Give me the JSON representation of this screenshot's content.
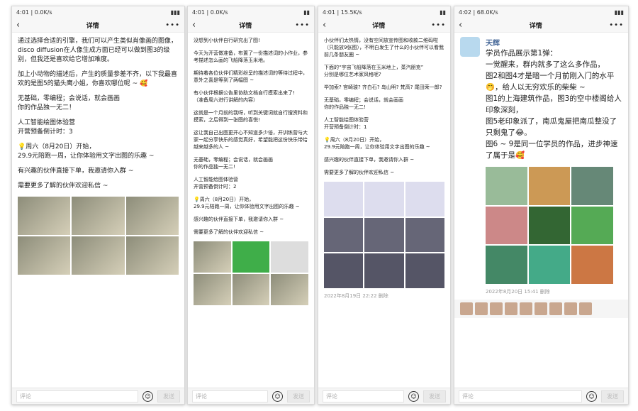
{
  "common": {
    "title": "详情",
    "comment_placeholder": "评论",
    "send": "发送",
    "more": "•••"
  },
  "phones": [
    {
      "time": "4:01 | 0.0K/s",
      "paras": [
        "通过选择合适的引擎，我们可以产生类似肖像画的图像，disco diffusion在人像生成方面已经可以做到图3的级别，但我还是喜欢给它增加难度。",
        "加上小动物的描述后，产生的质量参差不齐，以下我最喜欢的是图5的猫头鹰小姐，你喜欢哪位呢 ~ 🥰",
        "无基础，零编程；会说话，就会画画\n你的作品独一无二！",
        "人工智能绘图体验营\n开营预备倒计时：3",
        "💡周六（8月20日）开始，\n29.9元陪跑一周，让你体验用文字出图的乐趣 ~",
        "有兴趣的伙伴直接下单，我邀请你入群 ~",
        "需要更多了解的伙伴欢迎私信 ~"
      ]
    },
    {
      "time": "4:01 | 0.0K/s",
      "paras": [
        "没想到小伙伴自行研究出了图!",
        "今天为开营做准备，布置了一份描述词的小作业，参考描述怎么画的飞船降落玉米地。",
        "期待着各位伙伴们精彩纷呈的描述词的等待过程中，意外之喜是等到了两幅图 ~",
        "有小伙伴根据公告里协助文档自行摸索出来了!\n（准备周六进行讲解的内容）",
        "这就是一个月前的我呀，听到关键词就自行搜资料和摸索，之后得到一张图的喜悦!",
        "这让我自己出图更开心不知道多少倍，开训练营与大家一起分享快乐的感觉真好，希望能把这份快乐带给越来越多的人 ~",
        "无基础，零编程；会说话，就会画画\n你的作品独一无二!",
        "人工智能绘图体验营\n开营预备倒计时：2",
        "💡周六（8月20日）开始，\n29.9元陪跑一周，让你体验用文字出图的乐趣 ~",
        "感兴趣的伙伴直接下单，我邀请你入群 ~",
        "需要更多了解的伙伴欢迎私信 ~"
      ]
    },
    {
      "time": "4:01 | 15.5K/s",
      "paras": [
        "小伙伴们太热情，没有空间放宣传图和收款二维码啦（只能放9张图），不明白发生了什么的小伙伴可以看我前几条朋友圈 ~",
        "下面的“宇宙飞船降落在玉米地上，蒸汽朋克”\n分别是哪位艺术家风格呢?",
        "毕加索? 宫崎骏? 齐白石? 岛山明? 梵高? 尾田荣一郎?",
        "无基础，零编程；会说话，就会画画\n你的作品独一无二!",
        "人工智能绘图体验营\n开营预备倒计时：1",
        "💡周六（8月20日）开始，\n29.9元陪跑一周，让你体验用文字出图的乐趣 ~",
        "感兴趣的伙伴直接下单，我邀请你入群 ~",
        "需要更多了解的伙伴欢迎私信 ~"
      ],
      "date": "2022年8月19日 22:22  删除"
    },
    {
      "time": "4:02 | 68.0K/s",
      "user": "天辉",
      "paras": [
        "学员作品展示第1弹：\n一觉醒来，群内就多了这么多作品，\n图2和图4才是暗一个月前刚入门的水平🤭，给人以无穷欢乐的柴柴 ~\n图1的上海建筑作品，图3的空中楼阁给人印象深刻，\n图5老印象派了，南瓜鬼屋把南瓜整没了只剩鬼了😂。\n图6 ~ 9是同一位学员的作品，进步神速了属于是🥰"
      ],
      "date": "2022年8月20日 15:41  删除"
    }
  ]
}
